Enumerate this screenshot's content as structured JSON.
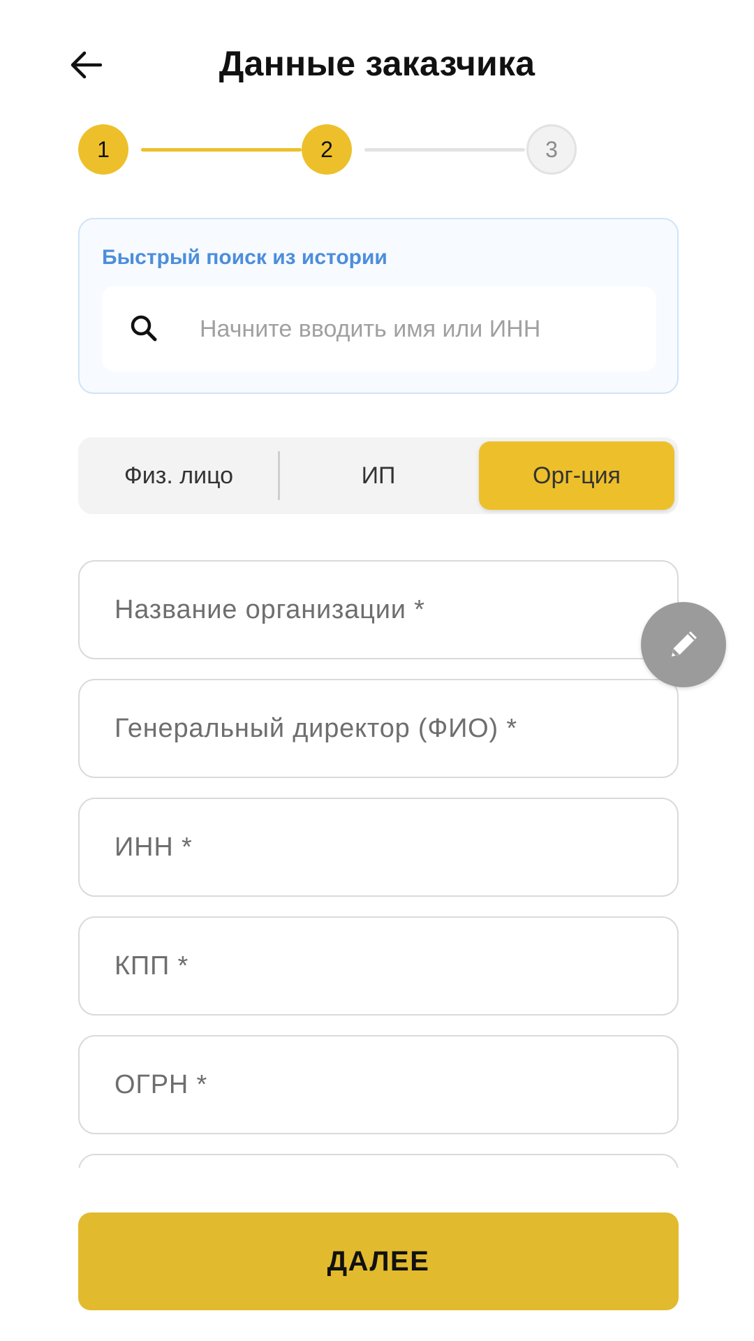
{
  "header": {
    "back_icon": "arrow-left-icon",
    "title": "Данные заказчика"
  },
  "stepper": {
    "steps": [
      {
        "label": "1",
        "state": "completed"
      },
      {
        "label": "2",
        "state": "active"
      },
      {
        "label": "3",
        "state": "inactive"
      }
    ],
    "active_color": "#EDC02B",
    "inactive_color": "#E2E2E2"
  },
  "quick_search": {
    "label": "Быстрый поиск из истории",
    "placeholder": "Начните вводить имя или ИНН",
    "value": "",
    "icon": "search-icon"
  },
  "customer_type": {
    "options": [
      "Физ. лицо",
      "ИП",
      "Орг-ция"
    ],
    "selected": "Орг-ция"
  },
  "form": {
    "fields": [
      {
        "placeholder": "Название организации *",
        "value": ""
      },
      {
        "placeholder": "Генеральный директор (ФИО) *",
        "value": ""
      },
      {
        "placeholder": "ИНН *",
        "value": ""
      },
      {
        "placeholder": "КПП *",
        "value": ""
      },
      {
        "placeholder": "ОГРН *",
        "value": ""
      },
      {
        "placeholder": "",
        "value": ""
      }
    ]
  },
  "fab": {
    "icon": "pencil-icon",
    "color": "#9B9B9B"
  },
  "footer": {
    "next_label": "ДАЛЕЕ",
    "next_color": "#E2BA2E"
  }
}
